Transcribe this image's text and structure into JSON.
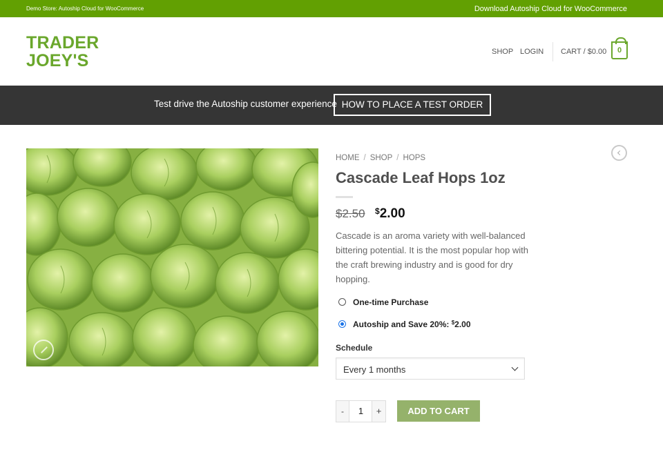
{
  "topbar": {
    "store_note": "Demo Store: Autoship Cloud for WooCommerce",
    "download_link": "Download Autoship Cloud for WooCommerce"
  },
  "header": {
    "logo_line1": "TRADER",
    "logo_line2": "JOEY'S",
    "nav_shop": "SHOP",
    "nav_login": "LOGIN",
    "cart_label": "CART / $0.00",
    "cart_count": "0"
  },
  "banner": {
    "text": "Test drive the Autoship customer experience",
    "button_label": "HOW TO PLACE A TEST ORDER"
  },
  "product": {
    "breadcrumb": [
      "HOME",
      "SHOP",
      "HOPS"
    ],
    "title": "Cascade Leaf Hops 1oz",
    "price_old": "$2.50",
    "price_new_symbol": "$",
    "price_new_amount": "2.00",
    "description": "Cascade is an aroma variety with well-balanced bittering potential. It is the most popular hop with the craft brewing industry and is good for dry hopping.",
    "option_one_time": "One-time Purchase",
    "option_autoship": "Autoship and Save 20%:",
    "option_autoship_price_symbol": "$",
    "option_autoship_price": "2.00",
    "selected_option": "autoship",
    "schedule_label": "Schedule",
    "schedule_value": "Every 1 months",
    "qty_minus": "-",
    "qty_value": "1",
    "qty_plus": "+",
    "add_to_cart": "ADD TO CART"
  },
  "colors": {
    "brand_green": "#62a002",
    "logo_green": "#6aa72c",
    "banner_dark": "#353535",
    "add_to_cart": "#95b26b"
  },
  "icons": [
    "zoom-icon",
    "previous-product-icon",
    "cart-icon",
    "chevron-down-icon"
  ]
}
